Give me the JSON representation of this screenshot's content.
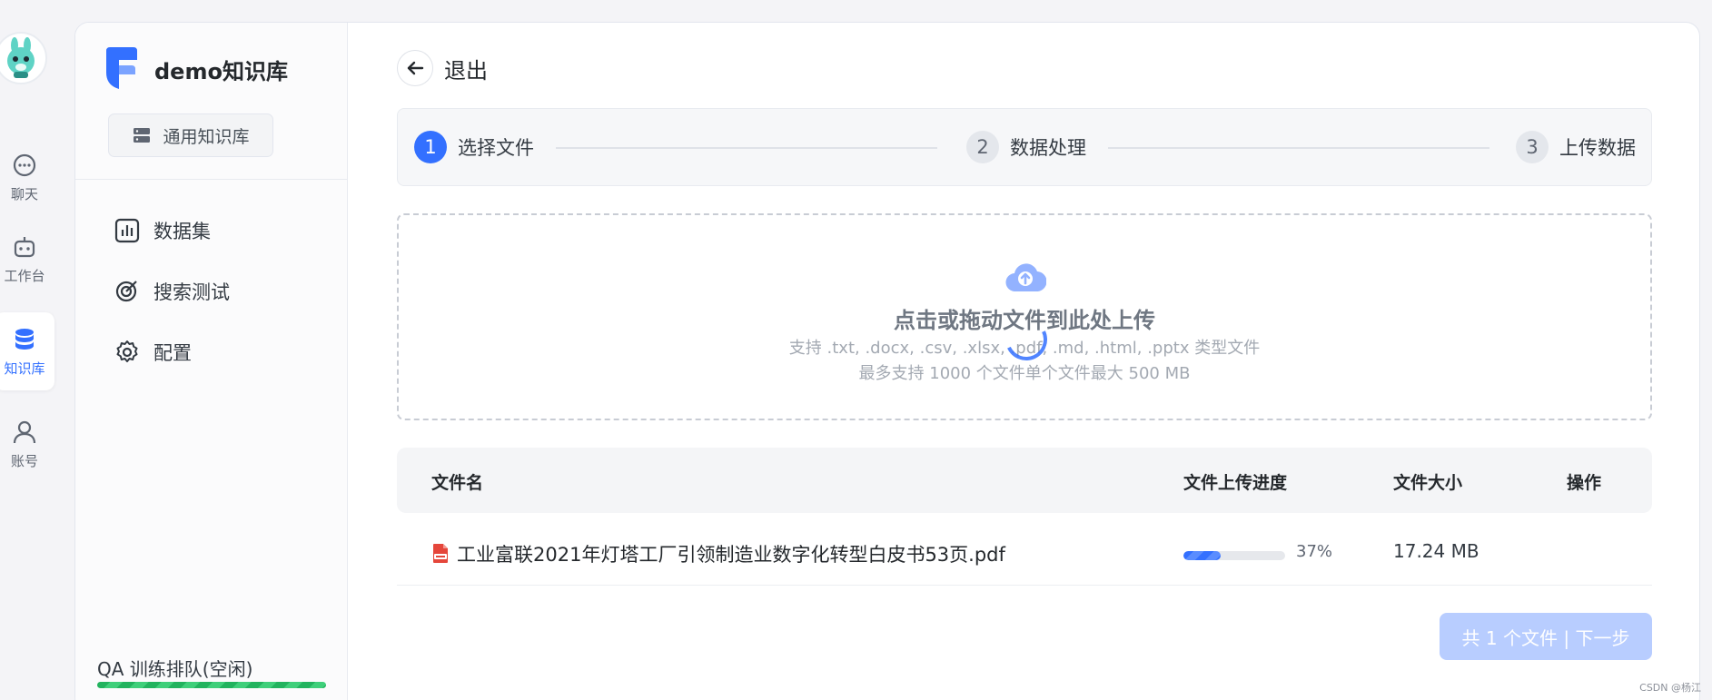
{
  "rail": {
    "items": [
      {
        "label": "聊天",
        "icon": "chat-icon"
      },
      {
        "label": "工作台",
        "icon": "robot-icon"
      },
      {
        "label": "知识库",
        "icon": "database-icon",
        "active": true
      },
      {
        "label": "账号",
        "icon": "user-icon"
      }
    ]
  },
  "kb": {
    "name": "demo知识库",
    "type_label": "通用知识库",
    "nav": [
      {
        "label": "数据集",
        "icon": "chart-icon"
      },
      {
        "label": "搜索测试",
        "icon": "search-test-icon"
      },
      {
        "label": "配置",
        "icon": "gear-icon"
      }
    ],
    "qa_status": "QA 训练排队(空闲)"
  },
  "back_label": "退出",
  "steps": [
    {
      "num": "1",
      "label": "选择文件",
      "active": true
    },
    {
      "num": "2",
      "label": "数据处理",
      "active": false
    },
    {
      "num": "3",
      "label": "上传数据",
      "active": false
    }
  ],
  "dropzone": {
    "title": "点击或拖动文件到此处上传",
    "subtitle": "支持 .txt, .docx, .csv, .xlsx, .pdf, .md, .html, .pptx 类型文件",
    "limit": "最多支持 1000 个文件单个文件最大 500 MB"
  },
  "table": {
    "headers": {
      "name": "文件名",
      "progress": "文件上传进度",
      "size": "文件大小",
      "action": "操作"
    },
    "rows": [
      {
        "name": "工业富联2021年灯塔工厂引领制造业数字化转型白皮书53页.pdf",
        "progress": 0.37,
        "progress_text": "37%",
        "size": "17.24 MB"
      }
    ]
  },
  "next_button": "共 1 个文件 | 下一步",
  "watermark": "CSDN @杨江",
  "colors": {
    "accent": "#3370ff",
    "success": "#22b35e"
  }
}
